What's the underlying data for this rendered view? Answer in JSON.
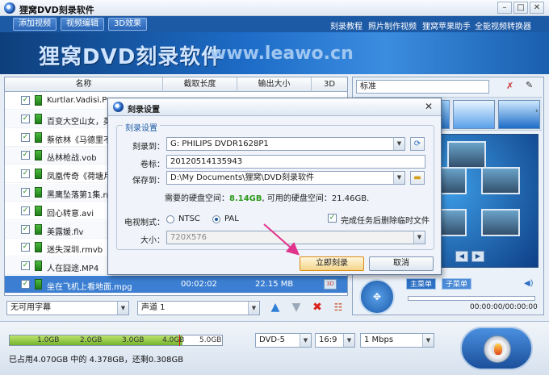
{
  "window": {
    "title": "狸窝DVD刻录软件",
    "minimize_glyph": "–",
    "maximize_glyph": "□",
    "close_glyph": "✕"
  },
  "menu": {
    "buttons": [
      "添加视频",
      "视频编辑",
      "3D效果"
    ],
    "links": [
      "刻录教程",
      "照片制作视频",
      "狸窝苹果助手",
      "全能视频转换器"
    ]
  },
  "banner": {
    "title": "狸窝DVD刻录软件",
    "url": "www.leawo.cn"
  },
  "list": {
    "headers": [
      "名称",
      "截取长度",
      "输出大小",
      "3D"
    ],
    "rows": [
      {
        "name": "Kurtlar.Vadisi.Pus...",
        "checked": "✓"
      },
      {
        "name": "百变大空山女，英",
        "checked": "✓"
      },
      {
        "name": "蔡依林《马德里不",
        "checked": "✓"
      },
      {
        "name": "丛林枪战.vob",
        "checked": "✓"
      },
      {
        "name": "凤凰传奇《荷塘月",
        "checked": "✓"
      },
      {
        "name": "黑鹰坠落第1集.rm",
        "checked": "✓"
      },
      {
        "name": "回心转意.avi",
        "checked": "✓"
      },
      {
        "name": "美露媛.flv",
        "checked": "✓"
      },
      {
        "name": "迷失深圳.rmvb",
        "checked": "✓"
      },
      {
        "name": "人在囧途.MP4",
        "checked": "✓"
      }
    ],
    "selected_row": {
      "name": "坐在飞机上看地面.mpg",
      "duration": "00:02:02",
      "size": "22.15 MB",
      "checked": "✓"
    }
  },
  "toolbar": {
    "subtitle": "无可用字幕",
    "audio": "声道 1"
  },
  "right_panel": {
    "template": "标准",
    "main_menu": "主菜单",
    "sub_menu": "子菜单",
    "time": "00:00:00/00:00:00",
    "prev_glyph": "◀",
    "next_glyph": "▶"
  },
  "bottom": {
    "capacity_ticks": [
      "1.0GB",
      "2.0GB",
      "3.0GB",
      "4.0GB",
      "5.0GB"
    ],
    "capacity_used_fraction": 0.814,
    "capacity_limit_fraction": 0.8,
    "disc_type": "DVD-5",
    "aspect": "16:9",
    "bitrate": "1 Mbps",
    "status": "已占用4.070GB 中的 4.378GB，还剩0.308GB"
  },
  "dialog": {
    "title": "刻录设置",
    "close_glyph": "✕",
    "group_label": "刻录设置",
    "burn_to_label": "刻录到：",
    "burn_to_value": "G: PHILIPS  DVDR1628P1",
    "volume_label": "卷标：",
    "volume_value": "20120514135943",
    "save_to_label": "保存到：",
    "save_to_value": "D:\\My Documents\\狸窝\\DVD刻录软件",
    "space_prefix": "需要的硬盘空间：",
    "space_need": "8.14GB",
    "space_suffix": ", 可用的硬盘空间：21.46GB.",
    "tv_label": "电视制式：",
    "ntsc": "NTSC",
    "pal": "PAL",
    "delete_temp_label": "完成任务后删除临时文件",
    "delete_temp_checked": "✓",
    "size_label": "大小：",
    "size_value": "720X576",
    "burn_now": "立即刻录",
    "cancel": "取消"
  },
  "colors": {
    "accent": "#1d5aa6",
    "selection": "#3c7fd2",
    "annotation_arrow": "#e0338c",
    "space_highlight": "#2b9a1a"
  }
}
